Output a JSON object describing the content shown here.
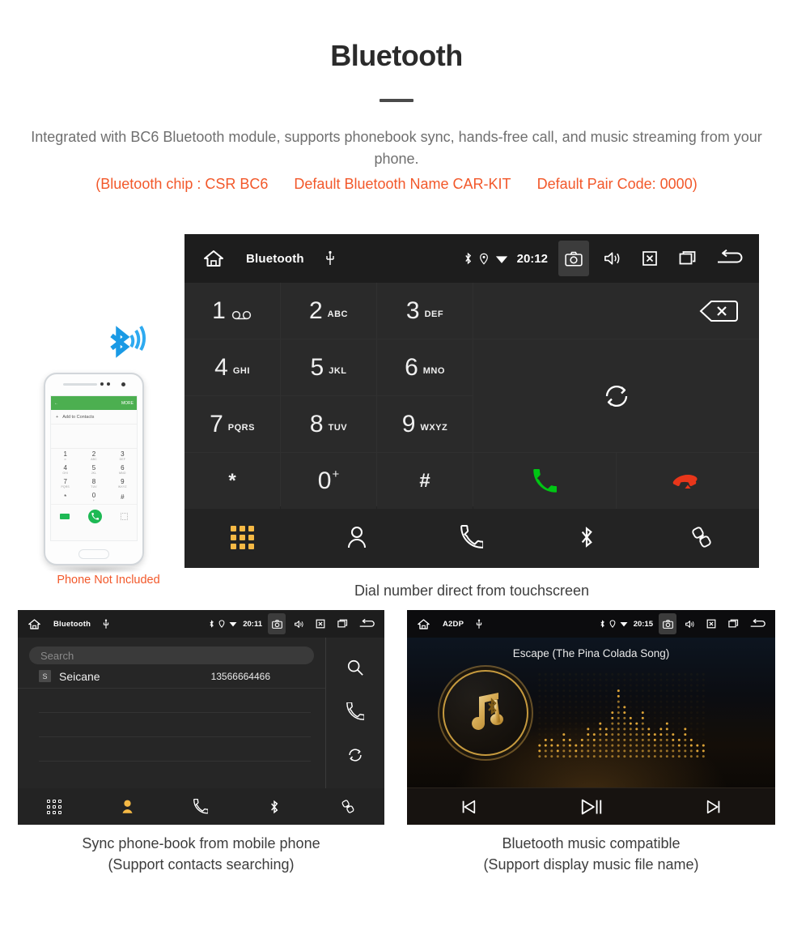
{
  "header": {
    "title": "Bluetooth",
    "subtitle": "Integrated with BC6 Bluetooth module, supports phonebook sync, hands-free call, and music streaming from your phone.",
    "spec_chip": "(Bluetooth chip : CSR BC6",
    "spec_name": "Default Bluetooth Name CAR-KIT",
    "spec_pair": "Default Pair Code: 0000)",
    "accent_color": "#f2582a",
    "text_color": "#6f6f6f"
  },
  "phone_illustration": {
    "bluetooth_icon": "bluetooth-wave-icon",
    "bt_color": "#1a9ae5",
    "screen": {
      "more_label": "MORE",
      "add_contact_label": "Add to Contacts",
      "keys": [
        {
          "num": "1",
          "sub": "∞"
        },
        {
          "num": "2",
          "sub": "ABC"
        },
        {
          "num": "3",
          "sub": "DEF"
        },
        {
          "num": "4",
          "sub": "GHI"
        },
        {
          "num": "5",
          "sub": "JKL"
        },
        {
          "num": "6",
          "sub": "MNO"
        },
        {
          "num": "7",
          "sub": "PQRS"
        },
        {
          "num": "8",
          "sub": "TUV"
        },
        {
          "num": "9",
          "sub": "WXYZ"
        },
        {
          "num": "*",
          "sub": ""
        },
        {
          "num": "0",
          "sub": "+"
        },
        {
          "num": "#",
          "sub": ""
        }
      ]
    },
    "not_included_label": "Phone Not Included"
  },
  "unit_dialer": {
    "statusbar": {
      "home_icon": "home-icon",
      "title": "Bluetooth",
      "usb_icon": "usb-icon",
      "bluetooth_icon": "bluetooth-icon",
      "location_icon": "location-pin-icon",
      "wifi_icon": "wifi-icon",
      "clock": "20:12",
      "camera_icon": "camera-icon",
      "volume_icon": "volume-icon",
      "mute_icon": "mute-icon",
      "recents_icon": "recents-icon",
      "back_icon": "back-icon"
    },
    "keys": [
      {
        "num": "1",
        "sub": "",
        "icon": "voicemail-icon"
      },
      {
        "num": "2",
        "sub": "ABC",
        "icon": ""
      },
      {
        "num": "3",
        "sub": "DEF",
        "icon": ""
      },
      {
        "num": "4",
        "sub": "GHI",
        "icon": ""
      },
      {
        "num": "5",
        "sub": "JKL",
        "icon": ""
      },
      {
        "num": "6",
        "sub": "MNO",
        "icon": ""
      },
      {
        "num": "7",
        "sub": "PQRS",
        "icon": ""
      },
      {
        "num": "8",
        "sub": "TUV",
        "icon": ""
      },
      {
        "num": "9",
        "sub": "WXYZ",
        "icon": ""
      },
      {
        "num": "*",
        "sub": "",
        "icon": ""
      },
      {
        "num": "0",
        "sup": "+",
        "sub": "",
        "icon": ""
      },
      {
        "num": "#",
        "sub": "",
        "icon": ""
      }
    ],
    "number_display_value": "",
    "backspace_icon": "backspace-icon",
    "swap_icon": "transfer-audio-icon",
    "call_icon": "call-icon",
    "endcall_icon": "end-call-icon",
    "call_color": "#00c514",
    "endcall_color": "#e8361a",
    "tabs": [
      {
        "name": "dialpad",
        "icon": "dialpad-icon",
        "active": true
      },
      {
        "name": "contacts",
        "icon": "contacts-icon",
        "active": false
      },
      {
        "name": "call-log",
        "icon": "call-log-icon",
        "active": false
      },
      {
        "name": "bluetooth",
        "icon": "bluetooth-icon",
        "active": false
      },
      {
        "name": "link",
        "icon": "link-icon",
        "active": false
      }
    ],
    "active_tab_color": "#f5b945",
    "caption": "Dial number direct from touchscreen"
  },
  "unit_phonebook": {
    "statusbar": {
      "title": "Bluetooth",
      "clock": "20:11"
    },
    "search_placeholder": "Search",
    "contacts": [
      {
        "initial": "S",
        "name": "Seicane",
        "number": "13566664466"
      }
    ],
    "empty_rows": 3,
    "rail": [
      {
        "name": "search",
        "icon": "search-icon"
      },
      {
        "name": "call",
        "icon": "call-log-icon"
      },
      {
        "name": "sync",
        "icon": "sync-icon"
      }
    ],
    "tabs": [
      {
        "name": "dialpad",
        "icon": "dialpad-icon",
        "active": false
      },
      {
        "name": "contacts",
        "icon": "contacts-icon",
        "active": true
      },
      {
        "name": "call-log",
        "icon": "call-log-icon",
        "active": false
      },
      {
        "name": "bluetooth",
        "icon": "bluetooth-icon",
        "active": false
      },
      {
        "name": "link",
        "icon": "link-icon",
        "active": false
      }
    ],
    "caption_line1": "Sync phone-book from mobile phone",
    "caption_line2": "(Support contacts searching)"
  },
  "unit_music": {
    "statusbar": {
      "title": "A2DP",
      "clock": "20:15"
    },
    "song_title": "Escape (The Pina Colada Song)",
    "album_icon": "music-note-bluetooth-icon",
    "accent_color": "#c69a3e",
    "visualizer": {
      "columns": 28,
      "rows": 16,
      "heights": [
        3,
        4,
        4,
        3,
        5,
        4,
        3,
        4,
        6,
        5,
        7,
        6,
        9,
        13,
        10,
        8,
        7,
        9,
        6,
        5,
        6,
        7,
        5,
        4,
        6,
        4,
        3,
        3
      ]
    },
    "controls": [
      {
        "name": "previous",
        "icon": "skip-previous-icon"
      },
      {
        "name": "play-pause",
        "icon": "play-pause-icon"
      },
      {
        "name": "next",
        "icon": "skip-next-icon"
      }
    ],
    "caption_line1": "Bluetooth music compatible",
    "caption_line2": "(Support display music file name)"
  }
}
